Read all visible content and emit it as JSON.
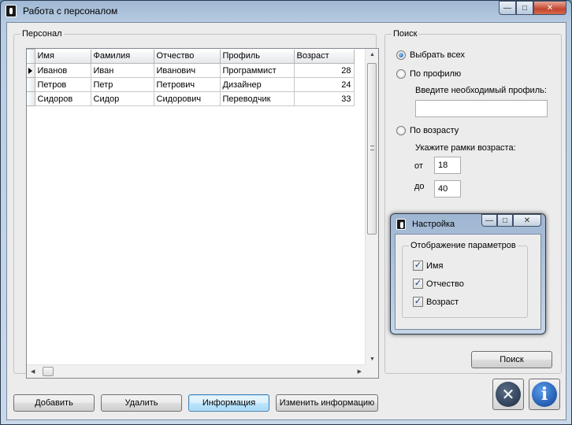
{
  "window": {
    "title": "Работа с персоналом",
    "icon": "app-icon",
    "min": "—",
    "max": "□",
    "close": "✕"
  },
  "personnel": {
    "legend": "Персонал",
    "columns": [
      "Имя",
      "Фамилия",
      "Отчество",
      "Профиль",
      "Возраст"
    ],
    "rows": [
      [
        "Иванов",
        "Иван",
        "Иванович",
        "Программист",
        "28"
      ],
      [
        "Петров",
        "Петр",
        "Петрович",
        "Дизайнер",
        "24"
      ],
      [
        "Сидоров",
        "Сидор",
        "Сидорович",
        "Переводчик",
        "33"
      ]
    ]
  },
  "search": {
    "legend": "Поиск",
    "opt_all": "Выбрать всех",
    "opt_profile": "По профилю",
    "profile_prompt": "Введите необходимый профиль:",
    "profile_value": "",
    "opt_age": "По возрасту",
    "age_prompt": "Укажите рамки возраста:",
    "from_label": "от",
    "from_value": "18",
    "to_label": "до",
    "to_value": "40",
    "button": "Поиск"
  },
  "buttons": {
    "add": "Добавить",
    "delete": "Удалить",
    "info": "Информация",
    "edit": "Изменить информацию"
  },
  "settings": {
    "title": "Настройка",
    "legend": "Отображение параметров",
    "items": [
      "Имя",
      "Отчество",
      "Возраст"
    ]
  }
}
